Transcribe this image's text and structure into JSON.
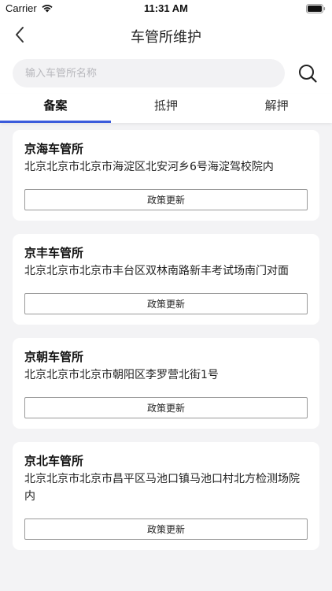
{
  "status_bar": {
    "carrier": "Carrier",
    "time": "11:31 AM"
  },
  "nav": {
    "title": "车管所维护",
    "back_icon": "chevron-left-icon"
  },
  "search": {
    "placeholder": "输入车管所名称",
    "value": "",
    "icon": "search-icon"
  },
  "tabs": [
    {
      "label": "备案",
      "active": true
    },
    {
      "label": "抵押",
      "active": false
    },
    {
      "label": "解押",
      "active": false
    }
  ],
  "accent_color": "#3b5bdb",
  "offices": [
    {
      "name": "京海车管所",
      "address": "北京北京市北京市海淀区北安河乡6号海淀驾校院内",
      "button": "政策更新"
    },
    {
      "name": "京丰车管所",
      "address": "北京北京市北京市丰台区双林南路新丰考试场南门对面",
      "button": "政策更新"
    },
    {
      "name": "京朝车管所",
      "address": "北京北京市北京市朝阳区李罗营北街1号",
      "button": "政策更新"
    },
    {
      "name": "京北车管所",
      "address": "北京北京市北京市昌平区马池口镇马池口村北方检测场院内",
      "button": "政策更新"
    }
  ]
}
